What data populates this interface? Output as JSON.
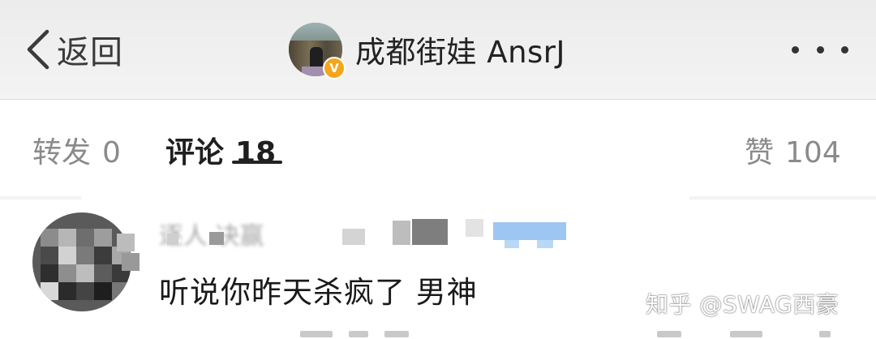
{
  "navbar": {
    "back_label": "返回",
    "title": "成都街娃 AnsrJ",
    "verified_mark": "V",
    "more_icon": "more-dots-icon"
  },
  "tabs": {
    "repost_label": "转发",
    "repost_count": "0",
    "comment_label": "评论",
    "comment_count": "18",
    "like_label": "赞",
    "like_count": "104"
  },
  "comment": {
    "user_name": "逐人 决赢",
    "text": "听说你昨天杀疯了 男神"
  },
  "watermark": "知乎 @SWAG西豪",
  "colors": {
    "navbar_bg": "#efefef",
    "verified_badge": "#f4a51c",
    "muted_text": "#8a8a8a"
  }
}
